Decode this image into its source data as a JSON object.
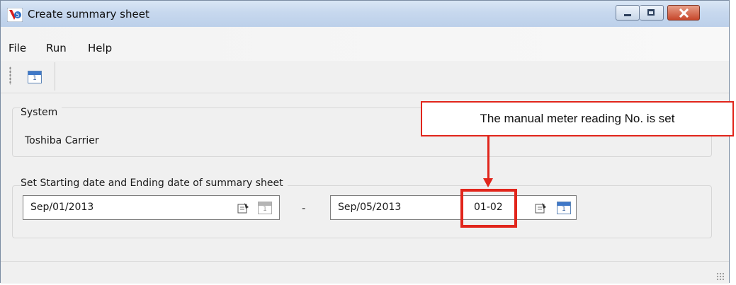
{
  "window": {
    "title": "Create summary sheet",
    "buttons": {
      "minimize": "minimize",
      "maximize": "maximize",
      "close": "close"
    }
  },
  "menu": {
    "items": [
      {
        "label": "File"
      },
      {
        "label": "Run"
      },
      {
        "label": "Help"
      }
    ]
  },
  "toolbar": {
    "calendar_icon_text": "1"
  },
  "system_group": {
    "title": "System",
    "value": "Toshiba Carrier"
  },
  "date_group": {
    "title": "Set Starting date and Ending date of summary sheet",
    "start_date": "Sep/01/2013",
    "separator": "-",
    "end_date": "Sep/05/2013",
    "meter_reading_no": "01-02"
  },
  "annotation": {
    "text": "The manual meter reading No. is set",
    "color": "#e1251b"
  },
  "icons": {
    "app": "app-logo-icon",
    "edit": "edit-icon",
    "calendar": "calendar-icon"
  }
}
